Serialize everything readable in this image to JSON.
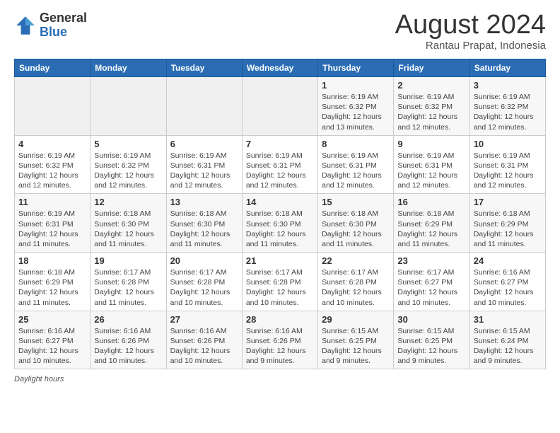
{
  "logo": {
    "general": "General",
    "blue": "Blue"
  },
  "title": "August 2024",
  "subtitle": "Rantau Prapat, Indonesia",
  "days_of_week": [
    "Sunday",
    "Monday",
    "Tuesday",
    "Wednesday",
    "Thursday",
    "Friday",
    "Saturday"
  ],
  "footer_label": "Daylight hours",
  "weeks": [
    [
      {
        "day": "",
        "info": ""
      },
      {
        "day": "",
        "info": ""
      },
      {
        "day": "",
        "info": ""
      },
      {
        "day": "",
        "info": ""
      },
      {
        "day": "1",
        "info": "Sunrise: 6:19 AM\nSunset: 6:32 PM\nDaylight: 12 hours\nand 13 minutes."
      },
      {
        "day": "2",
        "info": "Sunrise: 6:19 AM\nSunset: 6:32 PM\nDaylight: 12 hours\nand 12 minutes."
      },
      {
        "day": "3",
        "info": "Sunrise: 6:19 AM\nSunset: 6:32 PM\nDaylight: 12 hours\nand 12 minutes."
      }
    ],
    [
      {
        "day": "4",
        "info": "Sunrise: 6:19 AM\nSunset: 6:32 PM\nDaylight: 12 hours\nand 12 minutes."
      },
      {
        "day": "5",
        "info": "Sunrise: 6:19 AM\nSunset: 6:32 PM\nDaylight: 12 hours\nand 12 minutes."
      },
      {
        "day": "6",
        "info": "Sunrise: 6:19 AM\nSunset: 6:31 PM\nDaylight: 12 hours\nand 12 minutes."
      },
      {
        "day": "7",
        "info": "Sunrise: 6:19 AM\nSunset: 6:31 PM\nDaylight: 12 hours\nand 12 minutes."
      },
      {
        "day": "8",
        "info": "Sunrise: 6:19 AM\nSunset: 6:31 PM\nDaylight: 12 hours\nand 12 minutes."
      },
      {
        "day": "9",
        "info": "Sunrise: 6:19 AM\nSunset: 6:31 PM\nDaylight: 12 hours\nand 12 minutes."
      },
      {
        "day": "10",
        "info": "Sunrise: 6:19 AM\nSunset: 6:31 PM\nDaylight: 12 hours\nand 12 minutes."
      }
    ],
    [
      {
        "day": "11",
        "info": "Sunrise: 6:19 AM\nSunset: 6:31 PM\nDaylight: 12 hours\nand 11 minutes."
      },
      {
        "day": "12",
        "info": "Sunrise: 6:18 AM\nSunset: 6:30 PM\nDaylight: 12 hours\nand 11 minutes."
      },
      {
        "day": "13",
        "info": "Sunrise: 6:18 AM\nSunset: 6:30 PM\nDaylight: 12 hours\nand 11 minutes."
      },
      {
        "day": "14",
        "info": "Sunrise: 6:18 AM\nSunset: 6:30 PM\nDaylight: 12 hours\nand 11 minutes."
      },
      {
        "day": "15",
        "info": "Sunrise: 6:18 AM\nSunset: 6:30 PM\nDaylight: 12 hours\nand 11 minutes."
      },
      {
        "day": "16",
        "info": "Sunrise: 6:18 AM\nSunset: 6:29 PM\nDaylight: 12 hours\nand 11 minutes."
      },
      {
        "day": "17",
        "info": "Sunrise: 6:18 AM\nSunset: 6:29 PM\nDaylight: 12 hours\nand 11 minutes."
      }
    ],
    [
      {
        "day": "18",
        "info": "Sunrise: 6:18 AM\nSunset: 6:29 PM\nDaylight: 12 hours\nand 11 minutes."
      },
      {
        "day": "19",
        "info": "Sunrise: 6:17 AM\nSunset: 6:28 PM\nDaylight: 12 hours\nand 11 minutes."
      },
      {
        "day": "20",
        "info": "Sunrise: 6:17 AM\nSunset: 6:28 PM\nDaylight: 12 hours\nand 10 minutes."
      },
      {
        "day": "21",
        "info": "Sunrise: 6:17 AM\nSunset: 6:28 PM\nDaylight: 12 hours\nand 10 minutes."
      },
      {
        "day": "22",
        "info": "Sunrise: 6:17 AM\nSunset: 6:28 PM\nDaylight: 12 hours\nand 10 minutes."
      },
      {
        "day": "23",
        "info": "Sunrise: 6:17 AM\nSunset: 6:27 PM\nDaylight: 12 hours\nand 10 minutes."
      },
      {
        "day": "24",
        "info": "Sunrise: 6:16 AM\nSunset: 6:27 PM\nDaylight: 12 hours\nand 10 minutes."
      }
    ],
    [
      {
        "day": "25",
        "info": "Sunrise: 6:16 AM\nSunset: 6:27 PM\nDaylight: 12 hours\nand 10 minutes."
      },
      {
        "day": "26",
        "info": "Sunrise: 6:16 AM\nSunset: 6:26 PM\nDaylight: 12 hours\nand 10 minutes."
      },
      {
        "day": "27",
        "info": "Sunrise: 6:16 AM\nSunset: 6:26 PM\nDaylight: 12 hours\nand 10 minutes."
      },
      {
        "day": "28",
        "info": "Sunrise: 6:16 AM\nSunset: 6:26 PM\nDaylight: 12 hours\nand 9 minutes."
      },
      {
        "day": "29",
        "info": "Sunrise: 6:15 AM\nSunset: 6:25 PM\nDaylight: 12 hours\nand 9 minutes."
      },
      {
        "day": "30",
        "info": "Sunrise: 6:15 AM\nSunset: 6:25 PM\nDaylight: 12 hours\nand 9 minutes."
      },
      {
        "day": "31",
        "info": "Sunrise: 6:15 AM\nSunset: 6:24 PM\nDaylight: 12 hours\nand 9 minutes."
      }
    ]
  ]
}
